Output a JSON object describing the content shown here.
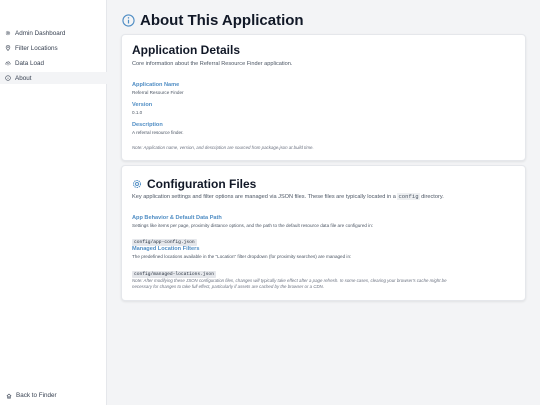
{
  "sidebar": {
    "items": [
      {
        "label": "Admin Dashboard",
        "icon": "gear-icon"
      },
      {
        "label": "Filter Locations",
        "icon": "location-pin-icon"
      },
      {
        "label": "Data Load",
        "icon": "cloud-upload-icon"
      },
      {
        "label": "About",
        "icon": "info-icon",
        "active": true
      }
    ],
    "back_label": "Back to Finder"
  },
  "page": {
    "title": "About This Application"
  },
  "details": {
    "heading": "Application Details",
    "subtitle": "Core information about the Referral Resource Finder application.",
    "name_label": "Application Name",
    "name_value": "Referral Resource Finder",
    "version_label": "Version",
    "version_value": "0.1.0",
    "description_label": "Description",
    "description_value": "A referral resource finder.",
    "note": "Note: Application name, version, and description are sourced from package.json at build time."
  },
  "config": {
    "heading": "Configuration Files",
    "subtitle_before": "Key application settings and filter options are managed via JSON files. These files are typically located in a",
    "subtitle_code": "config",
    "subtitle_after": "directory.",
    "app_label": "App Behavior & Default Data Path",
    "app_desc": "Settings like items per page, proximity distance options, and the path to the default resource data file are configured in:",
    "app_file": "config/app-config.json",
    "loc_label": "Managed Location Filters",
    "loc_desc": "The predefined locations available in the \"Location\" filter dropdown (for proximity searches) are managed in:",
    "loc_file": "config/managed-locations.json",
    "note_line1": "Note: After modifying these JSON configuration files, changes will typically take effect after a page refresh. In some cases, clearing your browser's cache might be",
    "note_line2": "necessary for changes to take full effect, particularly if assets are cached by the browser or a CDN."
  },
  "colors": {
    "accent": "#4f8dc4",
    "active_bg": "#f3f4f6",
    "page_bg": "#f3f4f6"
  }
}
